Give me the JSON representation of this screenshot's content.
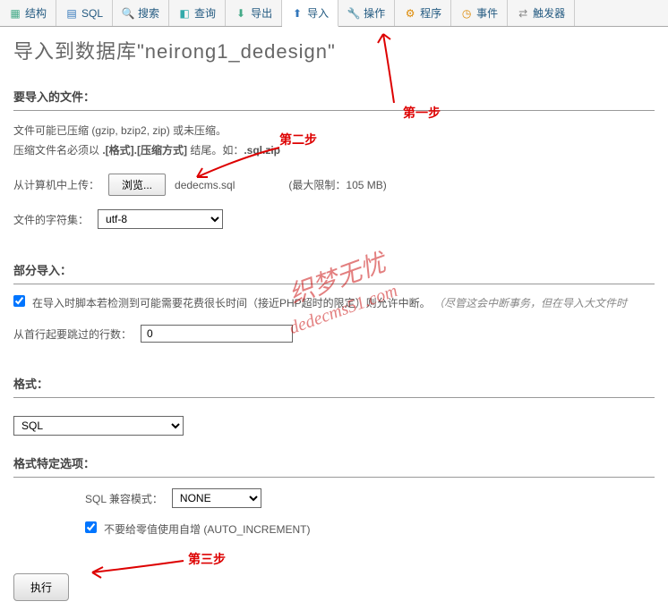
{
  "tabs": [
    {
      "label": "结构",
      "icon": "structure"
    },
    {
      "label": "SQL",
      "icon": "sql"
    },
    {
      "label": "搜索",
      "icon": "search"
    },
    {
      "label": "查询",
      "icon": "query"
    },
    {
      "label": "导出",
      "icon": "export"
    },
    {
      "label": "导入",
      "icon": "import",
      "active": true
    },
    {
      "label": "操作",
      "icon": "operations"
    },
    {
      "label": "程序",
      "icon": "routines"
    },
    {
      "label": "事件",
      "icon": "events"
    },
    {
      "label": "触发器",
      "icon": "triggers"
    }
  ],
  "page_title": "导入到数据库\"neirong1_dedesign\"",
  "sections": {
    "file_to_import": {
      "header": "要导入的文件：",
      "help1": "文件可能已压缩 (gzip, bzip2, zip) 或未压缩。",
      "help2_prefix": "压缩文件名必须以 ",
      "help2_bold": ".[格式].[压缩方式]",
      "help2_mid": " 结尾。如：",
      "help2_bold2": ".sql.zip",
      "upload_label": "从计算机中上传：",
      "browse_btn": "浏览...",
      "file_name": "dedecms.sql",
      "limit": "(最大限制：105 MB)",
      "charset_label": "文件的字符集：",
      "charset_value": "utf-8"
    },
    "partial_import": {
      "header": "部分导入：",
      "checkbox_text": "在导入时脚本若检测到可能需要花费很长时间（接近PHP超时的限定）则允许中断。",
      "checkbox_note": "（尽管这会中断事务，但在导入大文件时",
      "skip_label": "从首行起要跳过的行数：",
      "skip_value": "0"
    },
    "format": {
      "header": "格式：",
      "value": "SQL"
    },
    "format_options": {
      "header": "格式特定选项：",
      "compat_label": "SQL 兼容模式：",
      "compat_value": "NONE",
      "auto_inc_text": "不要给零值使用自增 (AUTO_INCREMENT)"
    }
  },
  "execute_btn": "执行",
  "annotations": {
    "step1": "第一步",
    "step2": "第二步",
    "step3": "第三步",
    "watermark1": "织梦无忧",
    "watermark2": "dedecms51.com"
  }
}
